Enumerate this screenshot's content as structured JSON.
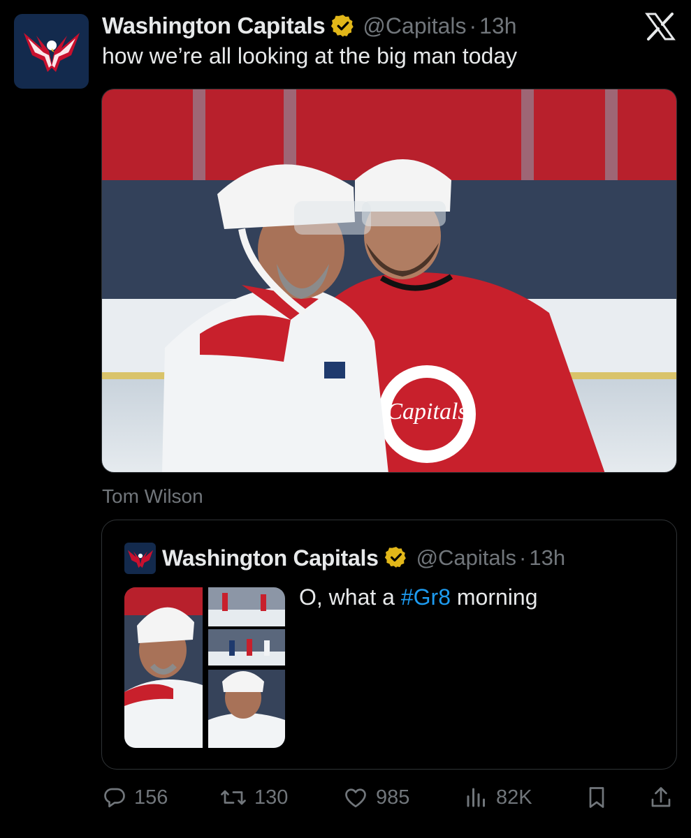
{
  "tweet": {
    "display_name": "Washington Capitals",
    "handle": "@Capitals",
    "separator": "·",
    "time": "13h",
    "text": "how we’re all looking at the big man today",
    "media_caption": "Tom Wilson"
  },
  "quoted_tweet": {
    "display_name": "Washington Capitals",
    "handle": "@Capitals",
    "separator": "·",
    "time": "13h",
    "text_before": "O, what a ",
    "hashtag": "#Gr8",
    "text_after": " morning"
  },
  "actions": {
    "replies": "156",
    "reposts": "130",
    "likes": "985",
    "views": "82K"
  },
  "colors": {
    "background": "#000000",
    "primary_text": "#e7e9ea",
    "secondary_text": "#71767b",
    "link": "#1d9bf0",
    "verified_gold": "#e2b719",
    "capitals_red": "#c8102e",
    "capitals_navy": "#041e42"
  },
  "icons": [
    "capitals-logo-icon",
    "verified-badge-icon",
    "x-logo-icon",
    "reply-icon",
    "repost-icon",
    "like-icon",
    "views-icon",
    "bookmark-icon",
    "share-icon"
  ]
}
